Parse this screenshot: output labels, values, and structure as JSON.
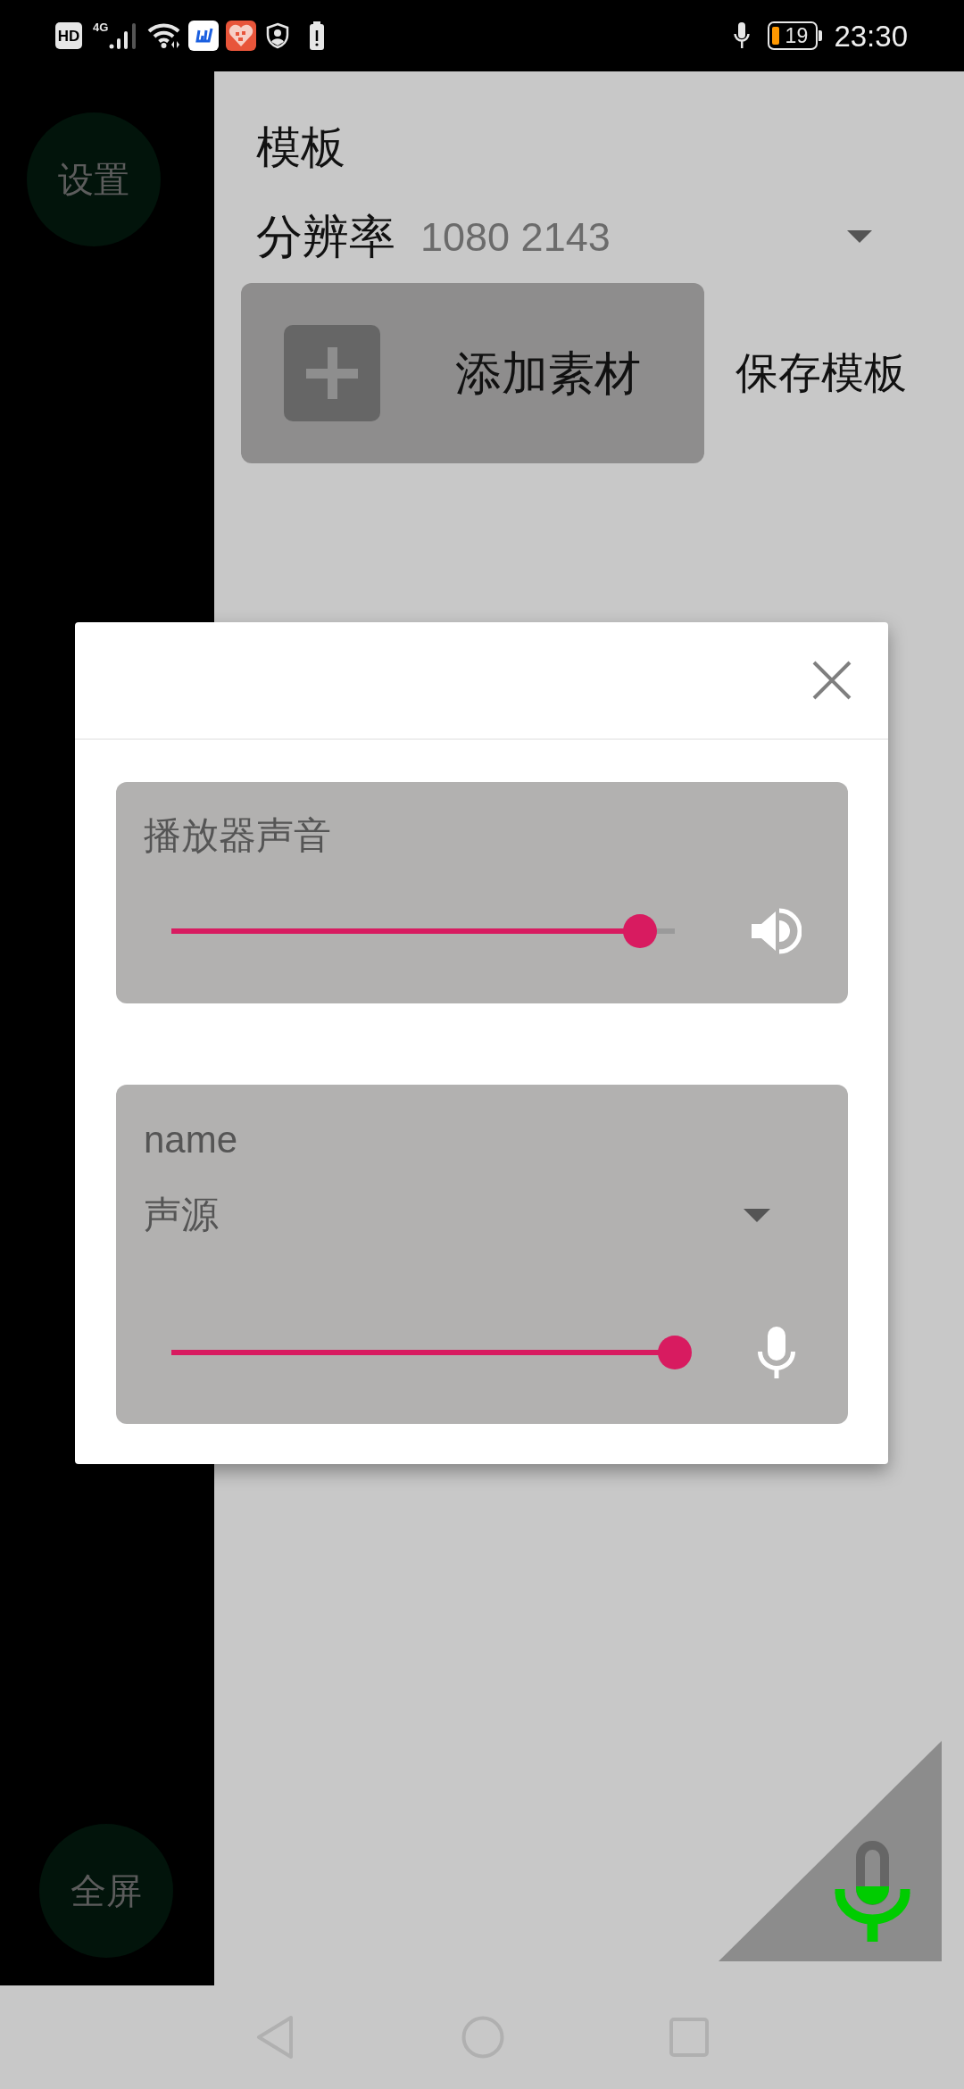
{
  "status_bar": {
    "hd": "HD",
    "network": "4G",
    "battery": "19",
    "time": "23:30"
  },
  "side_buttons": [
    {
      "label": "设置"
    },
    {
      "label": "全屏"
    }
  ],
  "template": {
    "title": "模板",
    "resolution_label": "分辨率",
    "resolution_value": "1080 2143",
    "add_button": "添加素材",
    "save_button": "保存模板"
  },
  "dialog": {
    "cards": [
      {
        "kind": "player",
        "title": "播放器声音",
        "level": 0.93
      },
      {
        "kind": "source",
        "title": "name",
        "source": "声源",
        "level": 1
      }
    ]
  }
}
